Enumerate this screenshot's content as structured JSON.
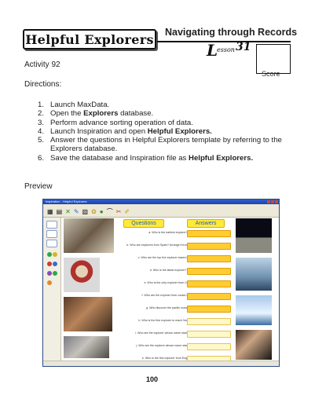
{
  "header": {
    "title": "Helpful Explorers",
    "topic": "Navigating through Records",
    "lesson_word": "esson",
    "lesson_letter": "L",
    "lesson_number": "31",
    "score_label": "Score"
  },
  "activity": "Activity 92",
  "directions_label": "Directions:",
  "steps": [
    {
      "num": "1.",
      "parts": [
        {
          "t": "Launch MaxData.",
          "b": false
        }
      ]
    },
    {
      "num": "2.",
      "parts": [
        {
          "t": "Open the ",
          "b": false
        },
        {
          "t": "Explorers",
          "b": true
        },
        {
          "t": " database.",
          "b": false
        }
      ]
    },
    {
      "num": "3.",
      "parts": [
        {
          "t": "Perform advance sorting operation of data.",
          "b": false
        }
      ]
    },
    {
      "num": "4.",
      "parts": [
        {
          "t": "Launch Inspiration and open ",
          "b": false
        },
        {
          "t": "Helpful Explorers.",
          "b": true
        }
      ]
    },
    {
      "num": "5.",
      "parts": [
        {
          "t": "Answer the questions in Helpful Explorers template by referring to the Explorers database.",
          "b": false
        }
      ]
    },
    {
      "num": "6.",
      "parts": [
        {
          "t": "Save the database and Inspiration file as ",
          "b": false
        },
        {
          "t": "Helpful Explorers.",
          "b": true
        }
      ]
    }
  ],
  "preview_label": "Preview",
  "preview": {
    "window_title": "Inspiration - Helpful Explorers",
    "questions_header": "Questions",
    "answers_header": "Answers",
    "questions": [
      "a. Who is the earliest explorer?",
      "b. Who are explorers from Spain? Arrange it from earliest to latest.",
      "c. Who are the top five explorer based on dates.",
      "d. Who is the latest explorer?",
      "e. Who is the only explorer from USA?",
      "f. Who are the explorer from costal union?",
      "g. Who discover the pacific ocean?",
      "h. Who is the first explorer to reach North pole?",
      "i. Who are the explorer whose name starts with \"M\"?",
      "j. Who are the explorer whose name start with \"A\"?",
      "k. Who is the first explorer from England?"
    ]
  },
  "page_number": "100"
}
